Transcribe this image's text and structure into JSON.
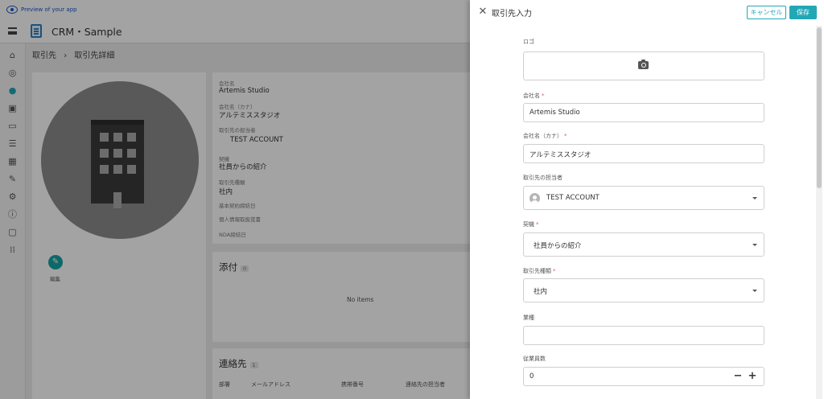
{
  "preview": {
    "text": "Preview of your app"
  },
  "app": {
    "title": "CRM・Sample"
  },
  "breadcrumb": {
    "parent": "取引先",
    "sep": "›",
    "current": "取引先詳細"
  },
  "profile": {
    "edit_label": "編集"
  },
  "details": {
    "company_name_label": "会社名",
    "company_name": "Artemis Studio",
    "company_kana_label": "会社名（カナ）",
    "company_kana": "アルテミススタジオ",
    "owner_label": "取引先の担当者",
    "owner": "TEST ACCOUNT",
    "trigger_label": "契機",
    "trigger": "社員からの紹介",
    "type_label": "取引先種類",
    "type": "社内",
    "basic_contract_label": "基本契約締結日",
    "privacy_label": "個人情報取扱覚書",
    "nda_label": "NDA締結日"
  },
  "attachments": {
    "title": "添付",
    "count": "0",
    "empty": "No items"
  },
  "contacts": {
    "title": "連絡先",
    "count": "1",
    "columns": [
      "部署",
      "メールアドレス",
      "携帯番号",
      "連絡先の担当者"
    ]
  },
  "drawer": {
    "title": "取引先入力",
    "cancel": "キャンセル",
    "save": "保存",
    "fields": {
      "logo": {
        "label": "ロゴ"
      },
      "company_name": {
        "label": "会社名",
        "required": "*",
        "value": "Artemis Studio"
      },
      "company_kana": {
        "label": "会社名（カナ）",
        "required": "*",
        "value": "アルテミススタジオ"
      },
      "owner": {
        "label": "取引先の担当者",
        "value": "TEST ACCOUNT"
      },
      "trigger": {
        "label": "契機",
        "required": "*",
        "value": "社員からの紹介"
      },
      "type": {
        "label": "取引先種類",
        "required": "*",
        "value": "社内"
      },
      "industry": {
        "label": "業種",
        "value": ""
      },
      "employees": {
        "label": "従業員数",
        "value": "0",
        "minus": "−",
        "plus": "+"
      }
    }
  },
  "icons": {
    "close": "close-icon",
    "camera": "camera-icon",
    "caret": "chevron-down-icon",
    "rail": [
      "home-icon",
      "account-circle-icon",
      "person-icon",
      "contacts-icon",
      "chat-icon",
      "list-icon",
      "image-icon",
      "person-edit-icon",
      "gear-icon",
      "info-icon",
      "feedback-icon",
      "apps-icon"
    ]
  },
  "colors": {
    "accent": "#23a7b5",
    "link": "#1a56c8",
    "required": "#e05a5a",
    "edit_button": "#16a3a3"
  }
}
